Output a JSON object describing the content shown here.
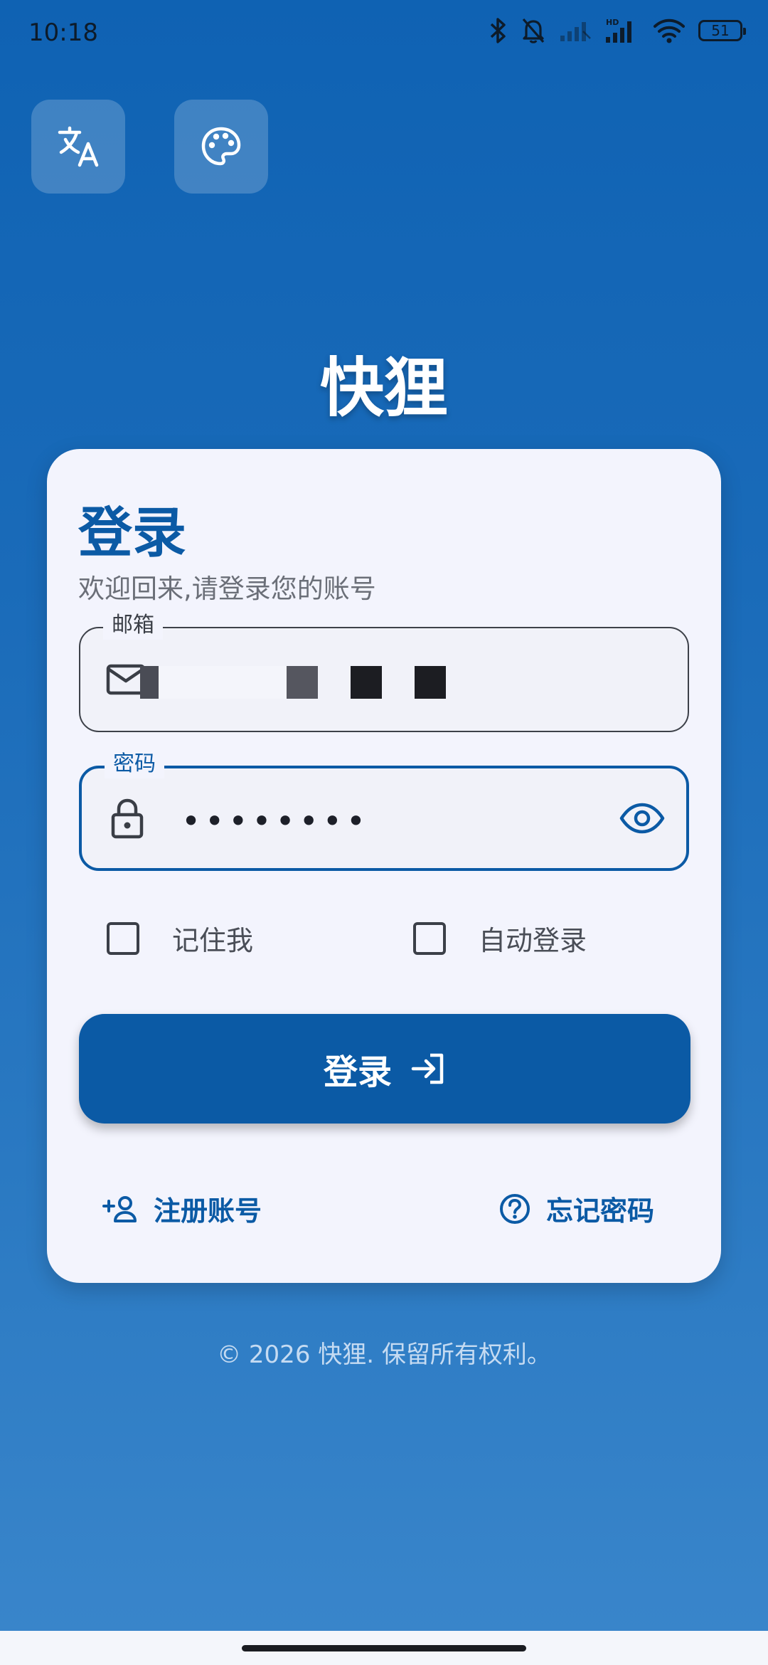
{
  "status_bar": {
    "time": "10:18",
    "network_badge": "HD",
    "battery_level": "51",
    "icons": [
      "bluetooth-icon",
      "bell-muted-icon",
      "signal-weak-icon",
      "signal-hd-icon",
      "wifi-icon",
      "battery-icon"
    ]
  },
  "toolbar": {
    "language_icon": "translate-icon",
    "theme_icon": "palette-icon"
  },
  "app": {
    "title": "快狸"
  },
  "login_card": {
    "heading": "登录",
    "subtitle": "欢迎回来,请登录您的账号",
    "email_field": {
      "label": "邮箱",
      "icon": "mail-icon",
      "value_redacted": true
    },
    "password_field": {
      "label": "密码",
      "icon": "lock-icon",
      "value": "••••••••",
      "toggle_icon": "eye-icon"
    },
    "remember_me": {
      "label": "记住我",
      "checked": false
    },
    "auto_login": {
      "label": "自动登录",
      "checked": false
    },
    "submit_button": {
      "label": "登录",
      "icon": "login-arrow-icon"
    },
    "register_link": {
      "label": "注册账号",
      "icon": "person-add-icon"
    },
    "forgot_link": {
      "label": "忘记密码",
      "icon": "help-circle-icon"
    }
  },
  "footer": {
    "copyright": "© 2026 快狸. 保留所有权利。"
  },
  "colors": {
    "primary": "#0b5aa5",
    "card_background": "#f3f4fd",
    "background_top": "#0f62b3",
    "background_bottom": "#3a86cb"
  }
}
